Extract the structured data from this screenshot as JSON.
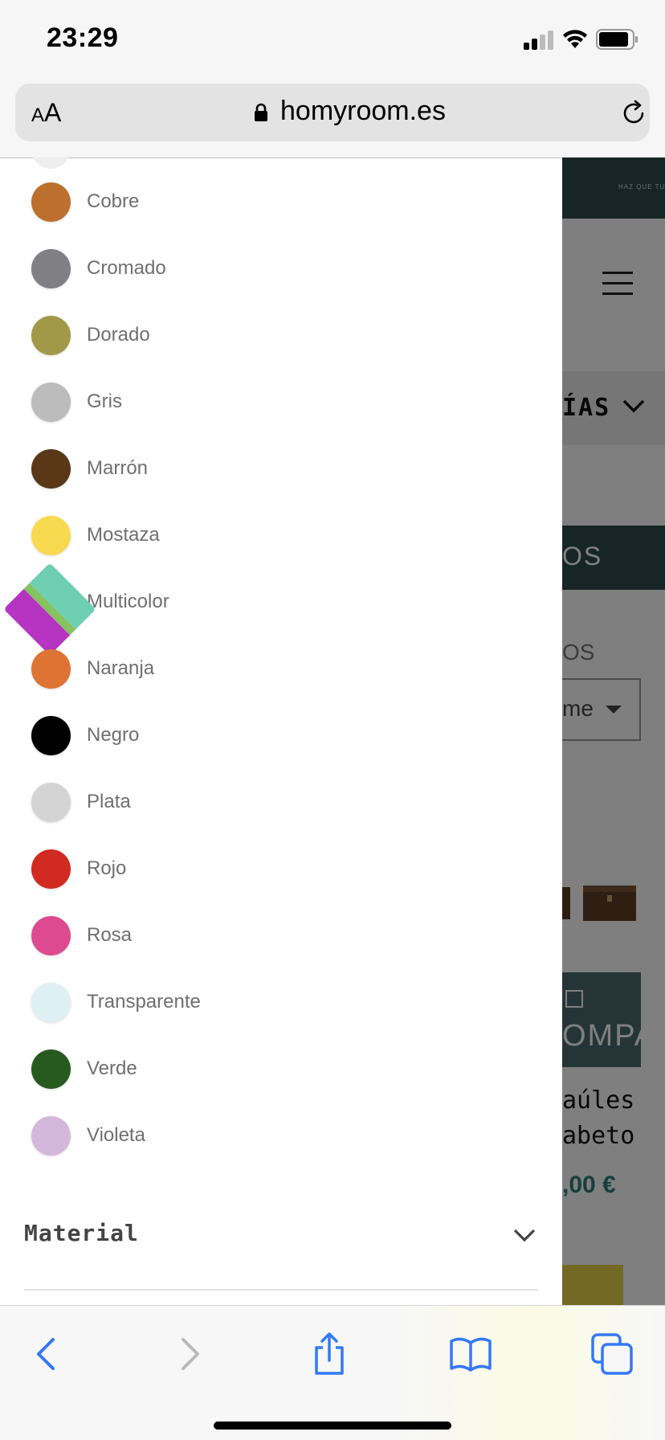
{
  "status_bar": {
    "time": "23:29"
  },
  "browser": {
    "text_size_small": "A",
    "text_size_large": "A",
    "url": "homyroom.es"
  },
  "background_page": {
    "tagline": "HAZ QUE TU",
    "categories_label": "ÍAS",
    "results_label": "OS",
    "sort_label": "OS",
    "sort_value": "me",
    "compare_label": "OMPA",
    "product_title_line1": "aúles",
    "product_title_line2": "abeto",
    "product_price": ",00 €"
  },
  "filter": {
    "colors": [
      {
        "label": "Cobre",
        "color": "#bd6f2e"
      },
      {
        "label": "Cromado",
        "color": "#808084"
      },
      {
        "label": "Dorado",
        "color": "#a29948"
      },
      {
        "label": "Gris",
        "color": "#bcbcbc"
      },
      {
        "label": "Marrón",
        "color": "#5a3717"
      },
      {
        "label": "Mostaza",
        "color": "#f7da4f"
      },
      {
        "label": "Multicolor",
        "color": "multicolor"
      },
      {
        "label": "Naranja",
        "color": "#dd7434"
      },
      {
        "label": "Negro",
        "color": "#000000"
      },
      {
        "label": "Plata",
        "color": "#d4d4d4"
      },
      {
        "label": "Rojo",
        "color": "#d12a20"
      },
      {
        "label": "Rosa",
        "color": "#de4a8f"
      },
      {
        "label": "Transparente",
        "color": "#dff0f5"
      },
      {
        "label": "Verde",
        "color": "#275a1f"
      },
      {
        "label": "Violeta",
        "color": "#d6b7dc"
      }
    ],
    "multicolor_colors": [
      "#6fcfb2",
      "#86c260",
      "#b535c2"
    ],
    "material_label": "Material"
  },
  "toolbar": {
    "accent": "#3478f6"
  }
}
